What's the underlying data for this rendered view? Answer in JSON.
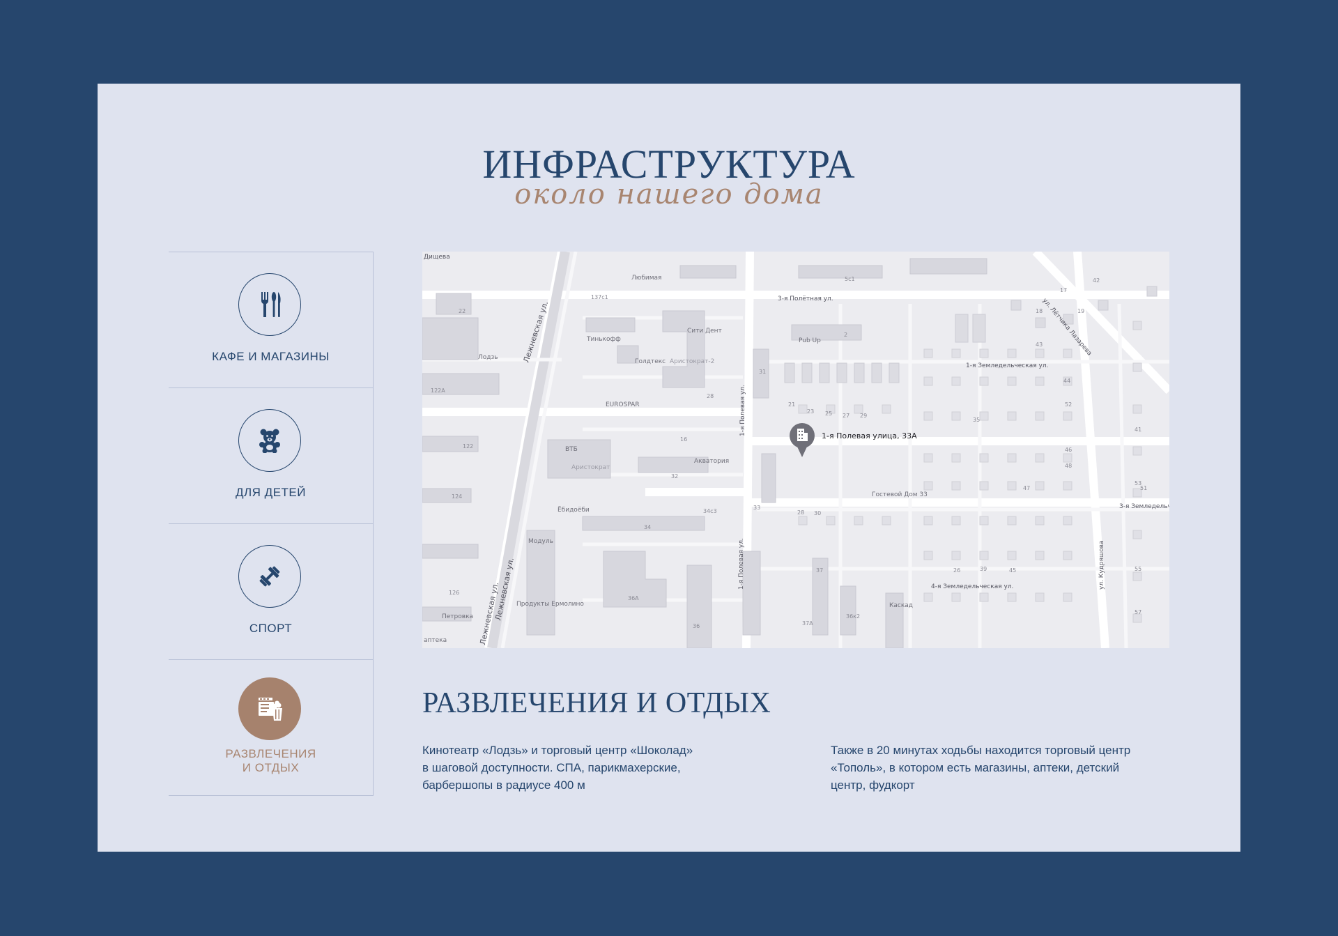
{
  "header": {
    "title": "ИНФРАСТРУКТУРА",
    "subtitle": "около нашего дома"
  },
  "tabs": [
    {
      "label": "КАФЕ И МАГАЗИНЫ",
      "icon": "cutlery-icon",
      "active": false
    },
    {
      "label": "ДЛЯ ДЕТЕЙ",
      "icon": "teddy-bear-icon",
      "active": false
    },
    {
      "label": "СПОРТ",
      "icon": "dumbbell-icon",
      "active": false
    },
    {
      "label": "РАЗВЛЕЧЕНИЯ\nИ ОТДЫХ",
      "icon": "cinema-popcorn-icon",
      "active": true
    }
  ],
  "map": {
    "marker_label": "1-я Полевая улица, 33А",
    "streets": [
      "Лежневская ул.",
      "Лежневская ул.",
      "Лежневская ул.",
      "3-я Полётная ул.",
      "ул. Лётчика Лазарева",
      "1-я Земледельческая ул.",
      "4-я Земледельческая ул.",
      "3-я Земледельче",
      "1-я Полевая ул.",
      "1-я Полевая ул.",
      "ул. Кудряшова",
      "Дищева"
    ],
    "places": [
      "Любимая",
      "Тинькофф",
      "Голдтекс",
      "Аристократ-2",
      "Сити Дент",
      "EUROSPAR",
      "ВТБ",
      "Аристократ",
      "Акватория",
      "Ёбидоёби",
      "Модуль",
      "Продукты Ермолино",
      "Петровка",
      "Лодзь",
      "Pub Up",
      "Гостевой Дом 33",
      "Каскад",
      "аптека"
    ],
    "house_numbers": [
      "22",
      "122А",
      "122",
      "124",
      "126",
      "137с1",
      "28",
      "16",
      "32",
      "34",
      "34с3",
      "36А",
      "36",
      "37",
      "37А",
      "36к2",
      "31",
      "33",
      "2",
      "5с1",
      "42",
      "19",
      "17",
      "18",
      "21",
      "23",
      "25",
      "27",
      "29",
      "35",
      "41",
      "43",
      "44",
      "46",
      "48",
      "52",
      "53",
      "55",
      "57",
      "51",
      "47",
      "45",
      "39",
      "26",
      "28",
      "30"
    ]
  },
  "section": {
    "title": "РАЗВЛЕЧЕНИЯ И ОТДЫХ",
    "text_left": "Кинотеатр «Лодзь» и торговый центр «Шоколад»\nв шаговой доступности. СПА, парикмахерские,\nбарбершопы в радиусе 400 м",
    "text_right": "Также в 20 минутах ходьбы находится торговый центр\n«Тополь», в котором есть магазины, аптеки, детский\nцентр, фудкорт"
  },
  "colors": {
    "background": "#26466d",
    "panel": "#dfe3ef",
    "primary": "#26466d",
    "accent": "#a6826d"
  }
}
